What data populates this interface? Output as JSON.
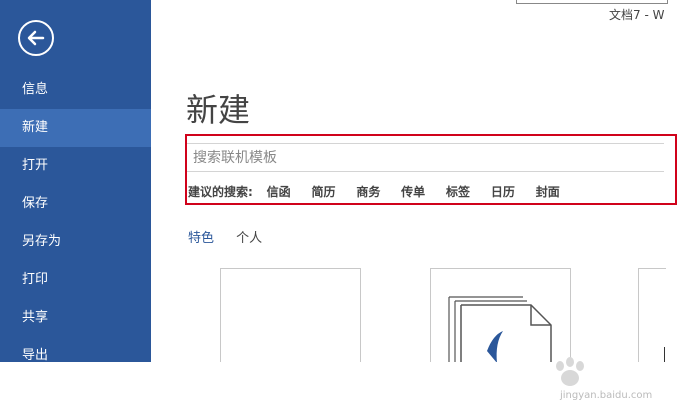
{
  "window": {
    "title_fragment": "文档7 - W"
  },
  "sidebar": {
    "items": [
      {
        "label": "信息",
        "active": false
      },
      {
        "label": "新建",
        "active": true
      },
      {
        "label": "打开",
        "active": false
      },
      {
        "label": "保存",
        "active": false
      },
      {
        "label": "另存为",
        "active": false
      },
      {
        "label": "打印",
        "active": false
      },
      {
        "label": "共享",
        "active": false
      },
      {
        "label": "导出",
        "active": false
      }
    ]
  },
  "main": {
    "title": "新建",
    "search": {
      "placeholder": "搜索联机模板",
      "value": ""
    },
    "suggested": {
      "label": "建议的搜索:",
      "items": [
        "信函",
        "简历",
        "商务",
        "传单",
        "标签",
        "日历",
        "封面"
      ]
    },
    "tabs": [
      {
        "label": "特色",
        "active": true
      },
      {
        "label": "个人",
        "active": false
      }
    ]
  },
  "watermark": {
    "text": "jingyan.baidu.com"
  },
  "colors": {
    "sidebar": "#2b579a",
    "sidebar_active": "#3d6eb5",
    "highlight": "#d0021b",
    "accent": "#2b579a"
  }
}
